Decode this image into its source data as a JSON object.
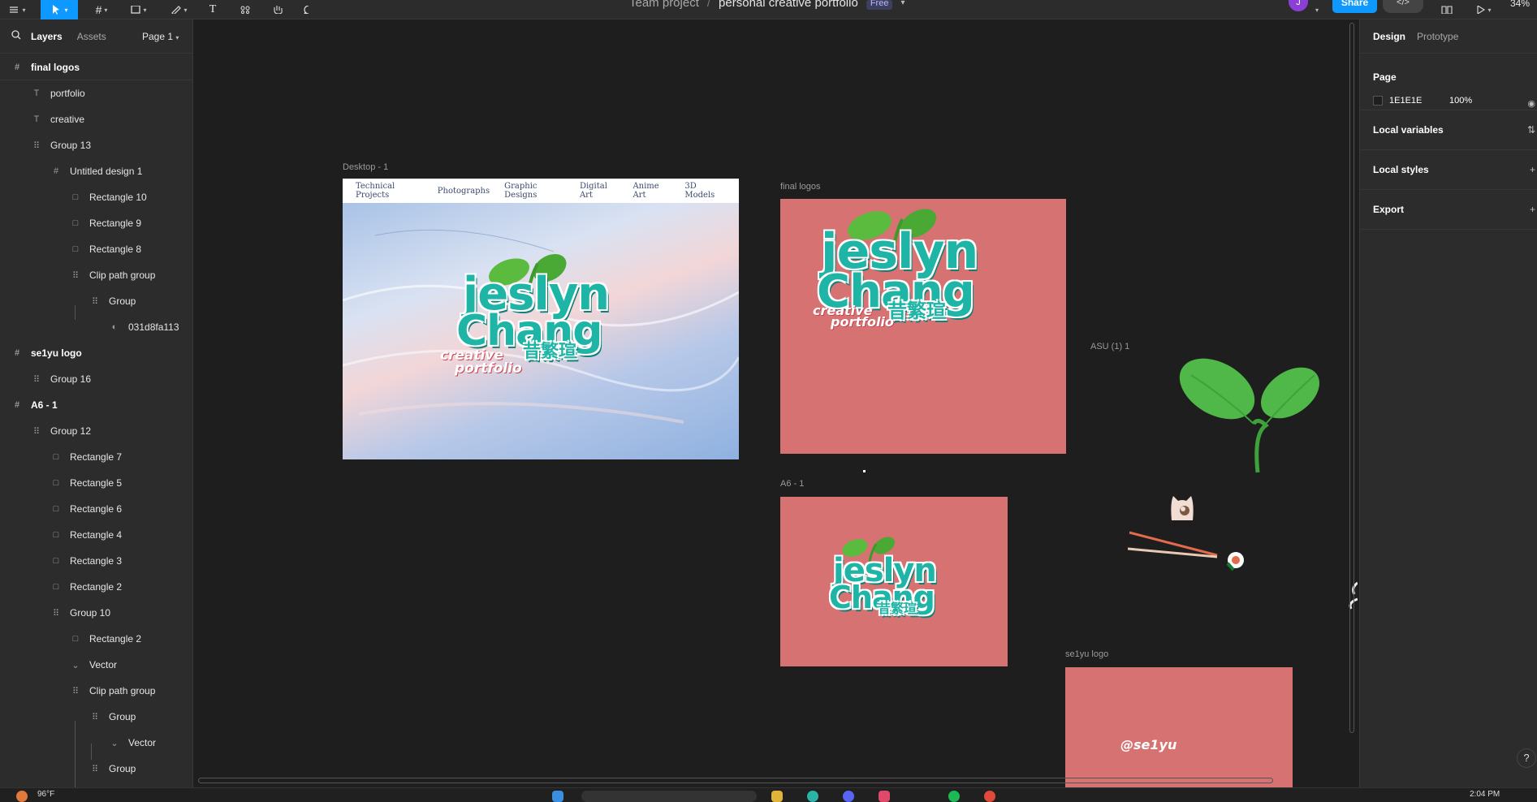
{
  "toolbar": {
    "file_team": "Team project",
    "file_sep": "/",
    "file_name": "personal creative portfolio",
    "plan_badge": "Free",
    "avatar_initial": "J",
    "share_label": "Share",
    "dev_mode_label": "</>",
    "zoom": "34%"
  },
  "left_panel": {
    "tabs": {
      "layers": "Layers",
      "assets": "Assets"
    },
    "page_selector": "Page 1",
    "layers": [
      {
        "label": "final logos",
        "icon": "frame-icon"
      },
      {
        "label": "portfolio",
        "icon": "text-icon"
      },
      {
        "label": "creative",
        "icon": "text-icon"
      },
      {
        "label": "Group 13",
        "icon": "group-icon"
      },
      {
        "label": "Untitled design 1",
        "icon": "frame-icon"
      },
      {
        "label": "Rectangle 10",
        "icon": "rectangle-icon"
      },
      {
        "label": "Rectangle 9",
        "icon": "rectangle-icon"
      },
      {
        "label": "Rectangle 8",
        "icon": "rectangle-icon"
      },
      {
        "label": "Clip path group",
        "icon": "group-icon"
      },
      {
        "label": "Group",
        "icon": "group-icon"
      },
      {
        "label": "031d8fa113",
        "icon": "image-icon"
      },
      {
        "label": "se1yu logo",
        "icon": "frame-icon"
      },
      {
        "label": "Group 16",
        "icon": "group-icon"
      },
      {
        "label": "A6 - 1",
        "icon": "frame-icon"
      },
      {
        "label": "Group 12",
        "icon": "group-icon"
      },
      {
        "label": "Rectangle 7",
        "icon": "rectangle-icon"
      },
      {
        "label": "Rectangle 5",
        "icon": "rectangle-icon"
      },
      {
        "label": "Rectangle 6",
        "icon": "rectangle-icon"
      },
      {
        "label": "Rectangle 4",
        "icon": "rectangle-icon"
      },
      {
        "label": "Rectangle 3",
        "icon": "rectangle-icon"
      },
      {
        "label": "Rectangle 2",
        "icon": "rectangle-icon"
      },
      {
        "label": "Group 10",
        "icon": "group-icon"
      },
      {
        "label": "Rectangle 2",
        "icon": "rectangle-icon"
      },
      {
        "label": "Vector",
        "icon": "vector-icon"
      },
      {
        "label": "Clip path group",
        "icon": "group-icon"
      },
      {
        "label": "Group",
        "icon": "group-icon"
      },
      {
        "label": "Vector",
        "icon": "vector-icon"
      },
      {
        "label": "Group",
        "icon": "group-icon"
      }
    ]
  },
  "canvas": {
    "frames": {
      "desktop": "Desktop - 1",
      "final_logos": "final logos",
      "asu": "ASU  (1) 1",
      "a6": "A6 - 1",
      "selyu": "se1yu logo"
    },
    "desktop_nav": [
      "Technical Projects",
      "Photographs",
      "Graphic Designs",
      "Digital Art",
      "Anime Art",
      "3D Models"
    ],
    "logo": {
      "line1": "jeslyn",
      "line2": "Chang",
      "chinese": "昔繁瑄",
      "sub1": "creative",
      "sub2": "portfolio"
    },
    "selyu_text": "@se1yu",
    "colors": {
      "pink": "#d67272",
      "teal": "#1fb5a6",
      "leaf": "#4fb848"
    }
  },
  "right_panel": {
    "tabs": {
      "design": "Design",
      "prototype": "Prototype"
    },
    "page_section": "Page",
    "page_color": "1E1E1E",
    "page_opacity": "100%",
    "local_variables": "Local variables",
    "local_styles": "Local styles",
    "export": "Export"
  },
  "taskbar": {
    "weather": "96°F",
    "time": "2:04 PM"
  },
  "help_label": "?"
}
